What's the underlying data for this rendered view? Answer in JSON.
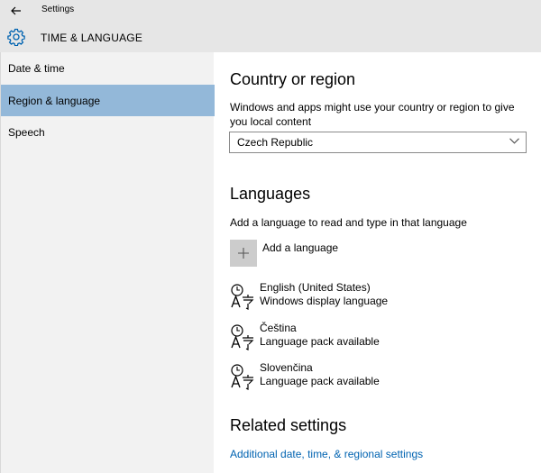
{
  "window": {
    "title": "Settings"
  },
  "header": {
    "title": "TIME & LANGUAGE"
  },
  "sidebar": {
    "items": [
      {
        "label": "Date & time"
      },
      {
        "label": "Region & language"
      },
      {
        "label": "Speech"
      }
    ],
    "selected": "Region & language"
  },
  "country": {
    "heading": "Country or region",
    "description": "Windows and apps might use your country or region to give you local content",
    "selected_value": "Czech Republic"
  },
  "languages": {
    "heading": "Languages",
    "description": "Add a language to read and type in that language",
    "add_label": "Add a language",
    "items": [
      {
        "name": "English (United States)",
        "status": "Windows display language"
      },
      {
        "name": "Čeština",
        "status": "Language pack available"
      },
      {
        "name": "Slovenčina",
        "status": "Language pack available"
      }
    ]
  },
  "related": {
    "heading": "Related settings",
    "link": "Additional date, time, & regional settings"
  },
  "colors": {
    "accent": "#93b8d9",
    "link": "#0063b1",
    "chrome": "#e6e6e6",
    "sidebar": "#f2f2f2"
  },
  "icons": {
    "back": "back-arrow-icon",
    "header": "gear-icon",
    "language": "language-icon",
    "add": "plus-icon",
    "dropdown": "chevron-down-icon"
  }
}
